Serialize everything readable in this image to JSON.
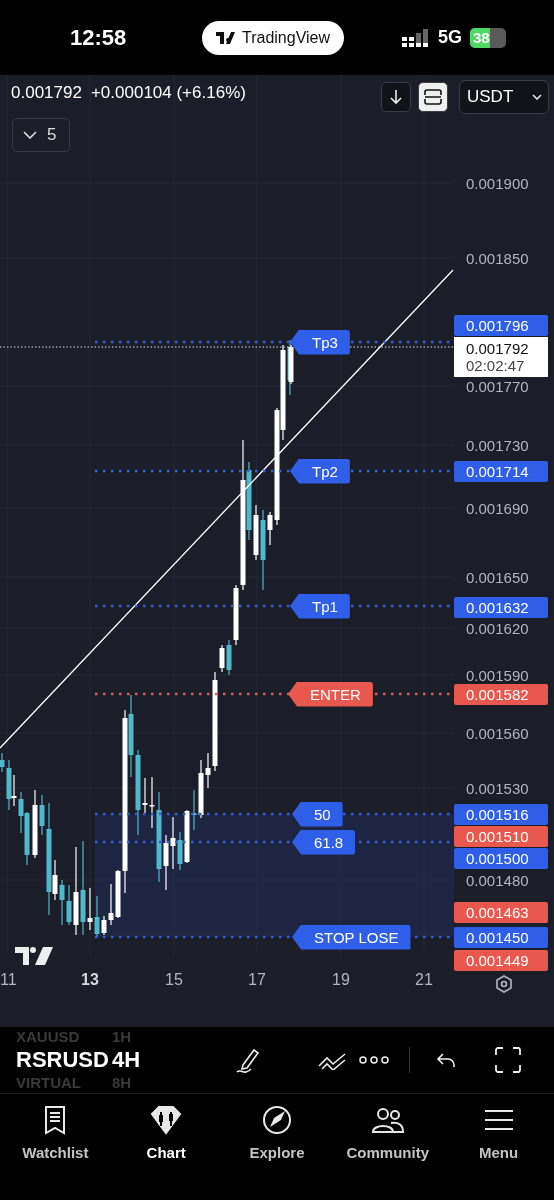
{
  "status_bar": {
    "time": "12:58",
    "app_pill": "TradingView",
    "network": "5G",
    "battery": "38"
  },
  "quote": {
    "price": "0.001792",
    "change": "+0.000104 (+6.16%)"
  },
  "chart_controls": [
    {
      "kind": "arrow",
      "selected": false
    },
    {
      "kind": "frame",
      "selected": true
    }
  ],
  "currency": "USDT",
  "indicators": {
    "count": "5",
    "expanded": false
  },
  "levels": [
    {
      "label": "Tp3",
      "color": "#2f5fe8"
    },
    {
      "label": "Tp2",
      "color": "#2f5fe8"
    },
    {
      "label": "Tp1",
      "color": "#2f5fe8"
    },
    {
      "label": "ENTER",
      "color": "#e8584f"
    },
    {
      "label": "50",
      "color": "#2f5fe8"
    },
    {
      "label": "61.8",
      "color": "#2f5fe8"
    },
    {
      "label": "STOP LOSE",
      "color": "#2f5fe8"
    }
  ],
  "price_axis": {
    "ticks": [
      "0.001900",
      "0.001850",
      "0.001770",
      "0.001730",
      "0.001690",
      "0.001650",
      "0.001620",
      "0.001590",
      "0.001560",
      "0.001530",
      "0.001480"
    ],
    "current": {
      "price": "0.001792",
      "countdown": "02:02:47"
    },
    "tags": [
      {
        "text": "0.001796",
        "color": "#2f5fe8"
      },
      {
        "text": "0.001714",
        "color": "#2f5fe8"
      },
      {
        "text": "0.001632",
        "color": "#2f5fe8"
      },
      {
        "text": "0.001582",
        "color": "#e8584f"
      },
      {
        "text": "0.001516",
        "color": "#2f5fe8"
      },
      {
        "text": "0.001510",
        "color": "#e8584f"
      },
      {
        "text": "0.001500",
        "color": "#2f5fe8"
      },
      {
        "text": "0.001463",
        "color": "#e8584f"
      },
      {
        "text": "0.001450",
        "color": "#2f5fe8"
      },
      {
        "text": "0.001449",
        "color": "#e8584f"
      }
    ]
  },
  "time_axis": [
    {
      "label": "11",
      "bold": false
    },
    {
      "label": "13",
      "bold": true
    },
    {
      "label": "15",
      "bold": false
    },
    {
      "label": "17",
      "bold": false
    },
    {
      "label": "19",
      "bold": false
    },
    {
      "label": "21",
      "bold": false
    }
  ],
  "symbols": [
    {
      "symbol": "XAUUSD",
      "interval": "1H",
      "selected": false
    },
    {
      "symbol": "RSRUSD",
      "interval": "4H",
      "selected": true
    },
    {
      "symbol": "VIRTUAL",
      "interval": "8H",
      "selected": false
    }
  ],
  "tabs": [
    {
      "label": "Watchlist",
      "selected": false
    },
    {
      "label": "Chart",
      "selected": true
    },
    {
      "label": "Explore",
      "selected": false
    },
    {
      "label": "Community",
      "selected": false
    },
    {
      "label": "Menu",
      "selected": false
    }
  ]
}
